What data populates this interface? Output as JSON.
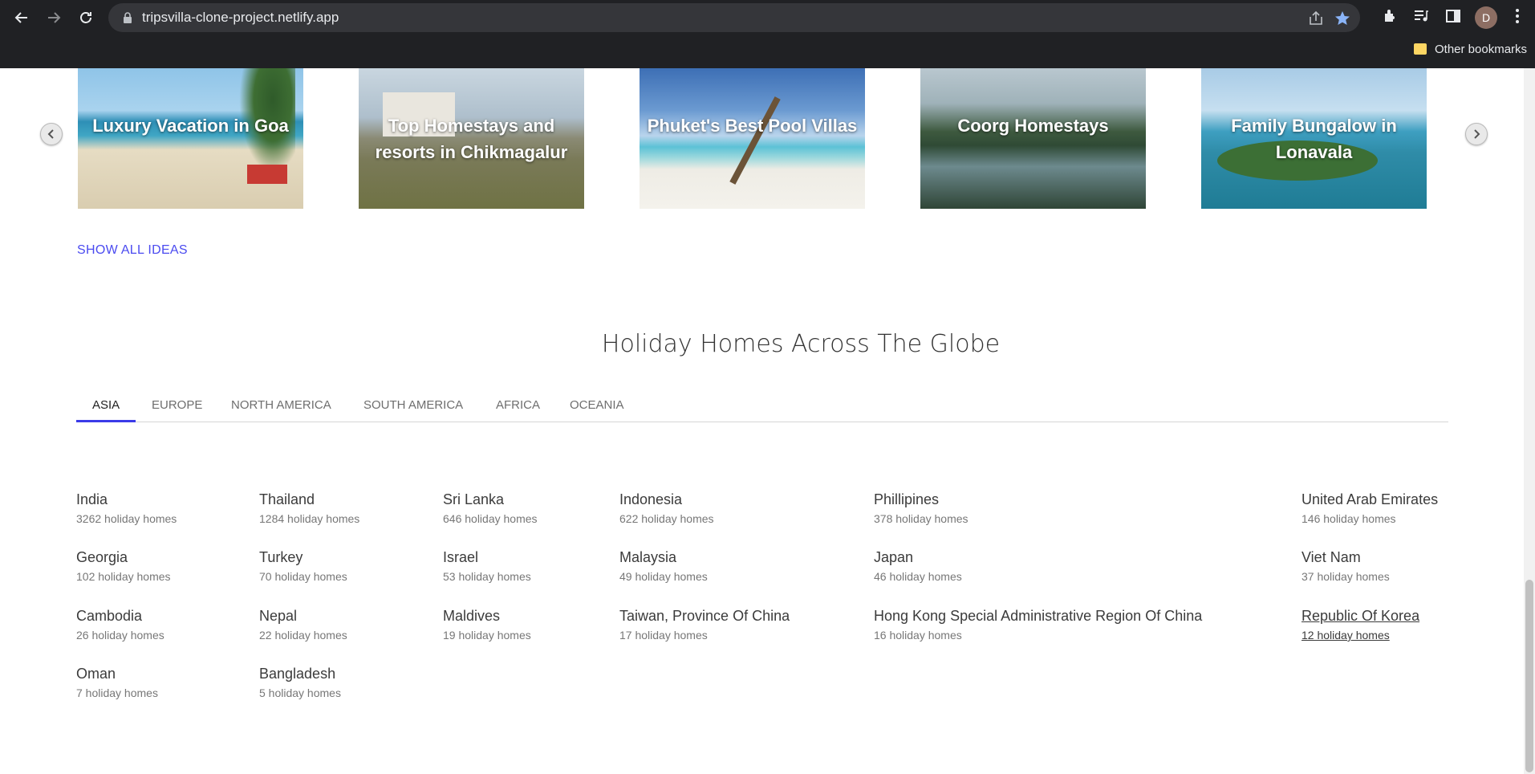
{
  "browser": {
    "url": "tripsvilla-clone-project.netlify.app",
    "avatar_letter": "D",
    "bookmarks_label": "Other bookmarks"
  },
  "carousel": {
    "cards": [
      {
        "title": "Luxury Vacation in Goa"
      },
      {
        "title": "Top Homestays and resorts in Chikmagalur"
      },
      {
        "title": "Phuket's Best Pool Villas"
      },
      {
        "title": "Coorg Homestays"
      },
      {
        "title": "Family Bungalow in Lonavala"
      }
    ],
    "show_all_label": "SHOW ALL IDEAS"
  },
  "section": {
    "title": "Holiday Homes Across The Globe",
    "tabs": [
      "ASIA",
      "EUROPE",
      "NORTH AMERICA",
      "SOUTH AMERICA",
      "AFRICA",
      "OCEANIA"
    ],
    "active_tab": "ASIA"
  },
  "countries": [
    {
      "name": "India",
      "count": "3262 holiday homes"
    },
    {
      "name": "Thailand",
      "count": "1284 holiday homes"
    },
    {
      "name": "Sri Lanka",
      "count": "646 holiday homes"
    },
    {
      "name": "Indonesia",
      "count": "622 holiday homes"
    },
    {
      "name": "Phillipines",
      "count": "378 holiday homes"
    },
    {
      "name": "United Arab Emirates",
      "count": "146 holiday homes"
    },
    {
      "name": "Georgia",
      "count": "102 holiday homes"
    },
    {
      "name": "Turkey",
      "count": "70 holiday homes"
    },
    {
      "name": "Israel",
      "count": "53 holiday homes"
    },
    {
      "name": "Malaysia",
      "count": "49 holiday homes"
    },
    {
      "name": "Japan",
      "count": "46 holiday homes"
    },
    {
      "name": "Viet Nam",
      "count": "37 holiday homes"
    },
    {
      "name": "Cambodia",
      "count": "26 holiday homes"
    },
    {
      "name": "Nepal",
      "count": "22 holiday homes"
    },
    {
      "name": "Maldives",
      "count": "19 holiday homes"
    },
    {
      "name": "Taiwan, Province Of China",
      "count": "17 holiday homes"
    },
    {
      "name": "Hong Kong Special Administrative Region Of China",
      "count": "16 holiday homes"
    },
    {
      "name": "Republic Of Korea",
      "count": "12 holiday homes"
    },
    {
      "name": "Oman",
      "count": "7 holiday homes"
    },
    {
      "name": "Bangladesh",
      "count": "5 holiday homes"
    }
  ]
}
